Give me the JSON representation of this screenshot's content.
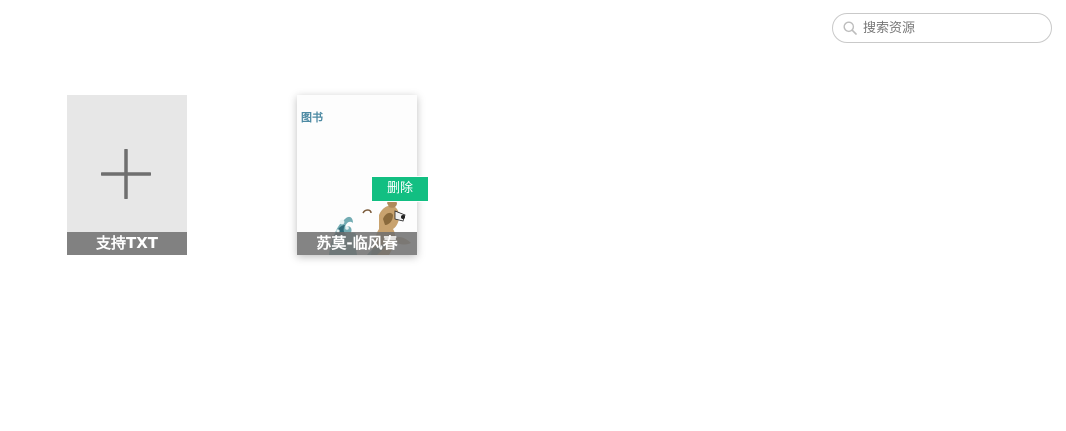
{
  "search": {
    "placeholder": "搜索资源",
    "value": "",
    "icon": "search-icon"
  },
  "add_card": {
    "label": "支持TXT",
    "icon": "plus-icon"
  },
  "books": [
    {
      "cover_tag": "图书",
      "title": "苏莫-临风春",
      "delete_label": "删除",
      "delete_color": "#12bf82"
    }
  ]
}
